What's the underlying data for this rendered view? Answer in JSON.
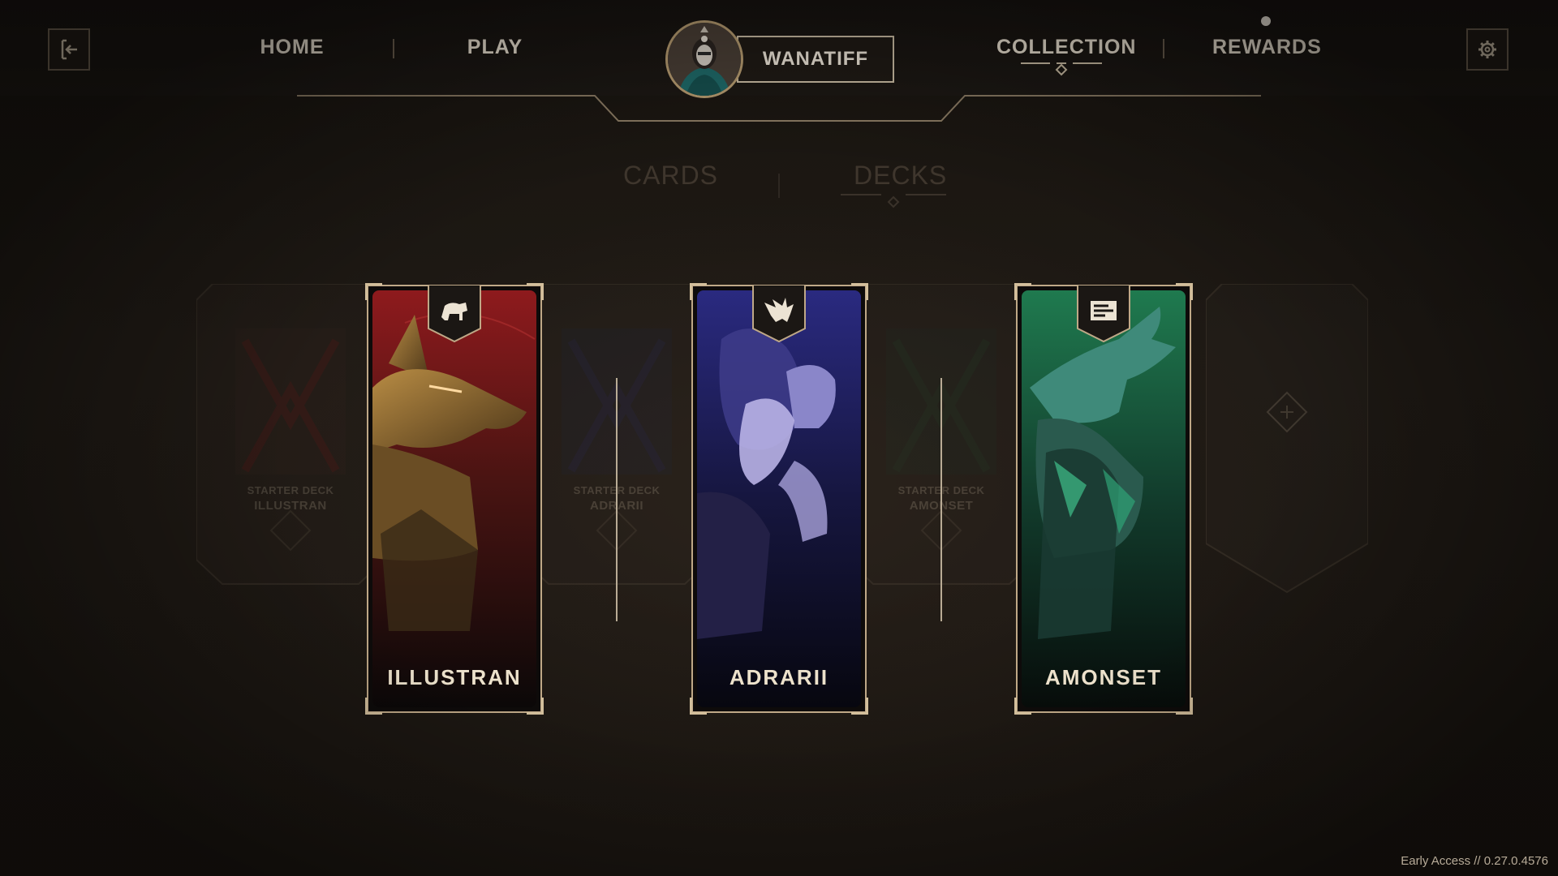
{
  "topbar": {
    "exit_icon": "exit-icon",
    "settings_icon": "gear-icon",
    "nav": {
      "home": "HOME",
      "play": "PLAY",
      "collection": "COLLECTION",
      "rewards": "REWARDS"
    },
    "active_nav": "COLLECTION",
    "rewards_notification": true,
    "profile": {
      "name": "WANATIFF"
    }
  },
  "subtabs": {
    "cards": "CARDS",
    "decks": "DECKS",
    "active": "DECKS"
  },
  "decks": [
    {
      "name": "ILLUSTRAN",
      "emblem": "lion-icon",
      "accent": "#8e1a1d"
    },
    {
      "name": "ADRARII",
      "emblem": "winged-beast-icon",
      "accent": "#2a2a80"
    },
    {
      "name": "AMONSET",
      "emblem": "crocodile-icon",
      "accent": "#1f7a4f"
    }
  ],
  "ghost_decks": [
    {
      "subtitle": "STARTER DECK",
      "name": "ILLUSTRAN"
    },
    {
      "subtitle": "STARTER DECK",
      "name": "ADRARII"
    },
    {
      "subtitle": "STARTER DECK",
      "name": "AMONSET"
    }
  ],
  "add_deck_icon": "plus-icon",
  "footer": {
    "version": "Early Access  //  0.27.0.4576"
  },
  "colors": {
    "background": "#1c1712",
    "gold_border": "#bfa887",
    "text": "#ece3d3"
  }
}
